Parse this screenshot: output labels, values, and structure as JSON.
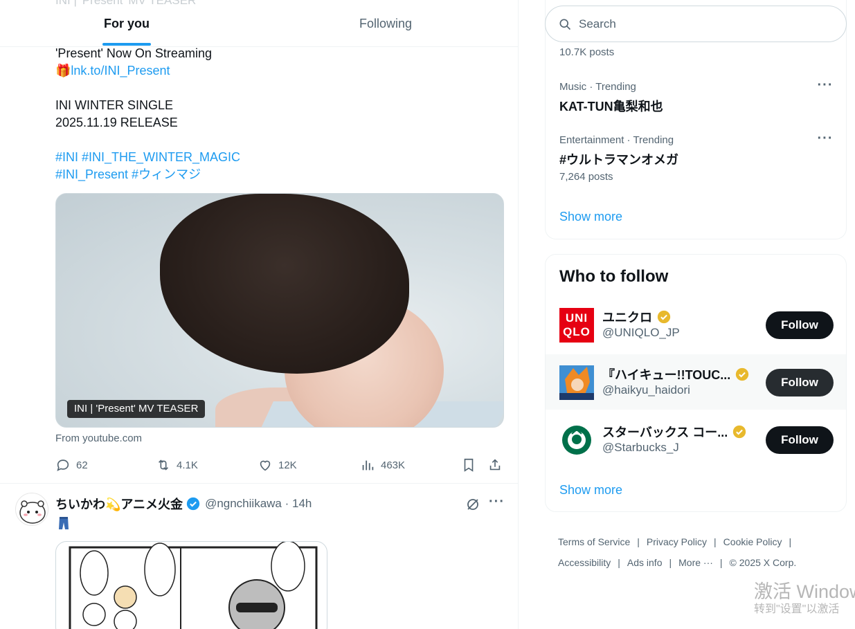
{
  "tabs": {
    "ghost_header": "INI | 'Present' MV TEASER",
    "for_you": "For you",
    "following": "Following"
  },
  "post1": {
    "line1": "'Present' Now On Streaming",
    "link": "lnk.to/INI_Present",
    "line3": "INI WINTER SINGLE",
    "line4": "2025.11.19 RELEASE",
    "hashtags1": "#INI #INI_THE_WINTER_MAGIC",
    "hashtags2": "#INI_Present #ウィンマジ",
    "card_label": "INI | 'Present' MV TEASER",
    "card_source": "From youtube.com",
    "replies": "62",
    "reposts": "4.1K",
    "likes": "12K",
    "views": "463K"
  },
  "post2": {
    "name": "ちいかわ💫アニメ火金",
    "handle": "@ngnchiikawa · 14h"
  },
  "search": {
    "placeholder": "Search"
  },
  "trends": {
    "top_count": "10.7K posts",
    "items": [
      {
        "meta": "Music · Trending",
        "title": "KAT-TUN亀梨和也"
      },
      {
        "meta": "Entertainment · Trending",
        "title": "#ウルトラマンオメガ",
        "count": "7,264 posts"
      }
    ],
    "show_more": "Show more"
  },
  "who_to_follow": {
    "title": "Who to follow",
    "items": [
      {
        "name": "ユニクロ",
        "handle": "@UNIQLO_JP",
        "button": "Follow",
        "logo_top": "UNI",
        "logo_bottom": "QLO"
      },
      {
        "name": "『ハイキュー!!TOUC...",
        "handle": "@haikyu_haidori",
        "button": "Follow"
      },
      {
        "name": "スターバックス コー...",
        "handle": "@Starbucks_J",
        "button": "Follow"
      }
    ],
    "show_more": "Show more"
  },
  "footer": {
    "terms": "Terms of Service",
    "privacy": "Privacy Policy",
    "cookie": "Cookie Policy",
    "accessibility": "Accessibility",
    "ads": "Ads info",
    "more": "More ···",
    "copyright": "© 2025 X Corp."
  },
  "watermark": {
    "line1": "激活 Window",
    "line2": "转到\"设置\"以激活"
  },
  "colors": {
    "accent": "#1d9bf0",
    "verified": "#e8b92d",
    "text_secondary": "#536471",
    "follow_button": "#0f1419"
  }
}
